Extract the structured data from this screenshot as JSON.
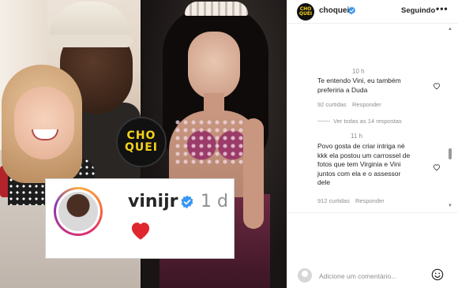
{
  "post": {
    "logo_line1": "CHO",
    "logo_line2": "QUEI",
    "embedded_card": {
      "username": "vinijr",
      "time": "1 d"
    }
  },
  "header": {
    "account": "choquei",
    "follow_label": "Seguindo",
    "more_label": "•••",
    "avatar_text": "CHO QUEI"
  },
  "comments": [
    {
      "time": "10 h",
      "text_lines": [
        "Te entendo Vini, eu também",
        "preferiria a Duda"
      ],
      "likes": "92 curtidas",
      "reply_label": "Responder"
    },
    {
      "time": "11 h",
      "text_lines": [
        "Povo gosta de criar intriga né",
        "kkk ela postou um carrossel de",
        "fotos que tem Virginia e Vini",
        "juntos com ela e o assessor",
        "dele"
      ],
      "likes": "912 curtidas",
      "reply_label": "Responder"
    }
  ],
  "replies_toggle": "Ver todas as 14 respostas",
  "footer": {
    "comment_placeholder": "Adicione um comentário..."
  },
  "colors": {
    "verified": "#3897f0",
    "logo_yellow": "#f5d21b",
    "heart_red": "#e0262e"
  }
}
